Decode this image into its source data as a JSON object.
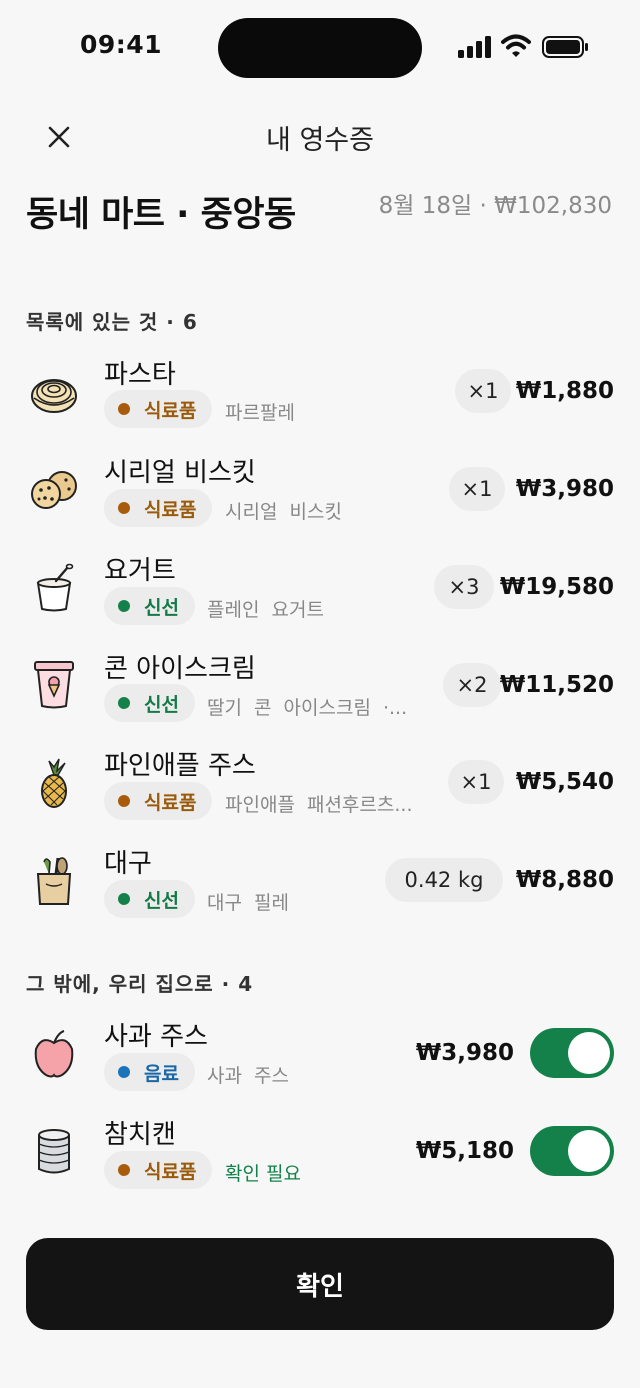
{
  "status_bar": {
    "time": "09:41"
  },
  "header": {
    "title": "내 영수증"
  },
  "store": {
    "name": "동네 마트 · 중앙동",
    "meta": "8월 18일 · ₩102,830"
  },
  "sections": {
    "on_list_title": "목록에 있는 것 · 6",
    "extra_title": "그 밖에, 우리 집으로 · 4"
  },
  "on_list_items": [
    {
      "name": "파스타",
      "category": "식료품",
      "desc": "파르팔레",
      "qty": "×1",
      "price": "₩1,880",
      "icon": "pasta-icon"
    },
    {
      "name": "시리얼 비스킷",
      "category": "식료품",
      "desc": "시리얼 비스킷",
      "qty": "×1",
      "price": "₩3,980",
      "icon": "cookie-icon"
    },
    {
      "name": "요거트",
      "category": "신선",
      "desc": "플레인 요거트",
      "qty": "×3",
      "price": "₩19,580",
      "icon": "yogurt-icon"
    },
    {
      "name": "콘 아이스크림",
      "category": "신선",
      "desc": "딸기 콘 아이스크림 ·...",
      "qty": "×2",
      "price": "₩11,520",
      "icon": "ice-cream-tub-icon"
    },
    {
      "name": "파인애플 주스",
      "category": "식료품",
      "desc": "파인애플 패션후르츠...",
      "qty": "×1",
      "price": "₩5,540",
      "icon": "pineapple-icon"
    },
    {
      "name": "대구",
      "category": "신선",
      "desc": "대구 필레",
      "qty": "0.42 kg",
      "price": "₩8,880",
      "icon": "grocery-bag-icon"
    }
  ],
  "extra_items": [
    {
      "name": "사과 주스",
      "category": "음료",
      "desc": "사과 주스",
      "note": "",
      "price": "₩3,980",
      "toggle_on": true,
      "icon": "apple-icon"
    },
    {
      "name": "참치캔",
      "category": "식료품",
      "desc": "",
      "note": "확인 필요",
      "price": "₩5,180",
      "toggle_on": true,
      "icon": "tin-can-icon"
    }
  ],
  "footer": {
    "confirm_label": "확인"
  },
  "colors": {
    "accent_green": "#138149",
    "food_brown": "#a85b0b",
    "drink_blue": "#1b74b9",
    "button_dark": "#141414"
  }
}
